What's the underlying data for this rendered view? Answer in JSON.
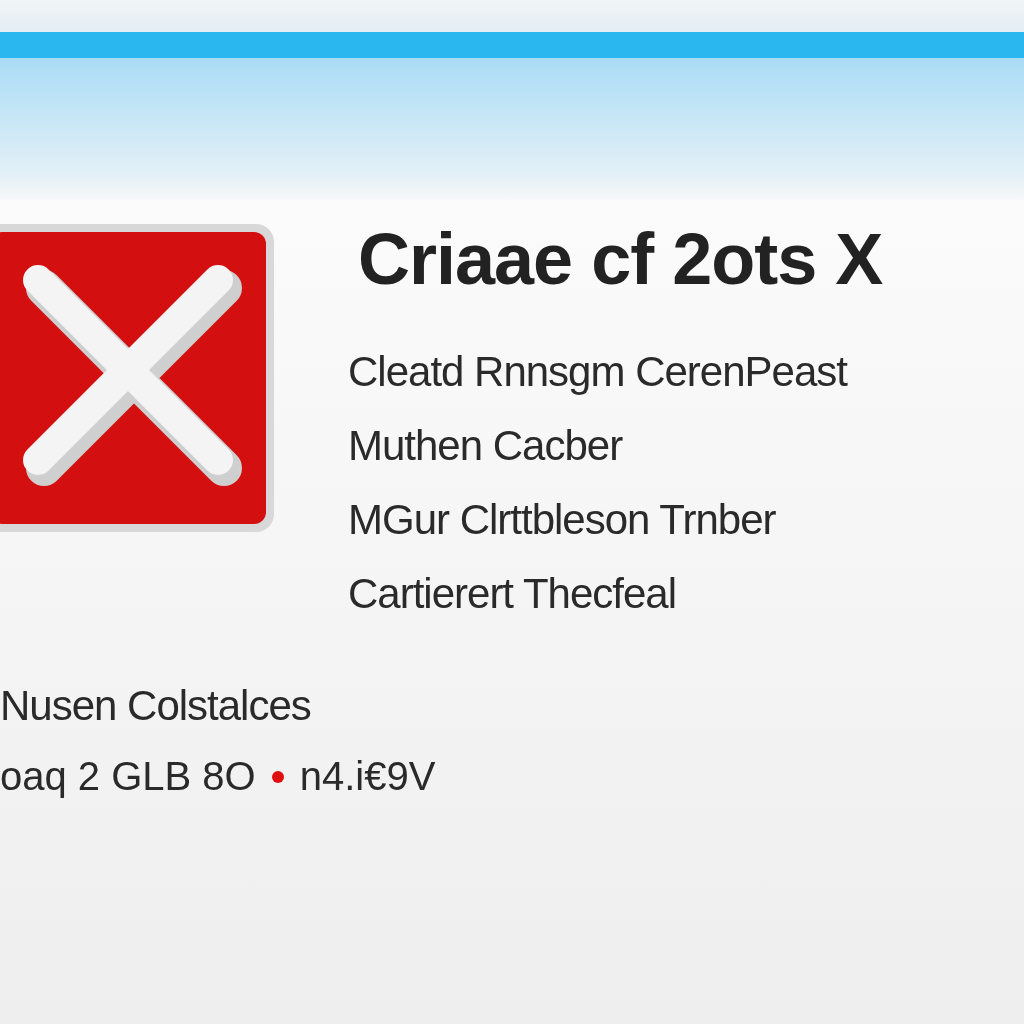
{
  "dialog": {
    "title": "Criaae cf 2ots X",
    "lines": [
      "Cleatd Rnnsgm CerenPeast",
      "Muthen Cacber",
      "MGur Clrttbleson Trnber",
      "Cartierert Thecfeal"
    ],
    "footer": {
      "heading": "Nusen Colstalces",
      "code": "oaq 2 GLB 8O",
      "detail": "n4.i€9V"
    }
  }
}
